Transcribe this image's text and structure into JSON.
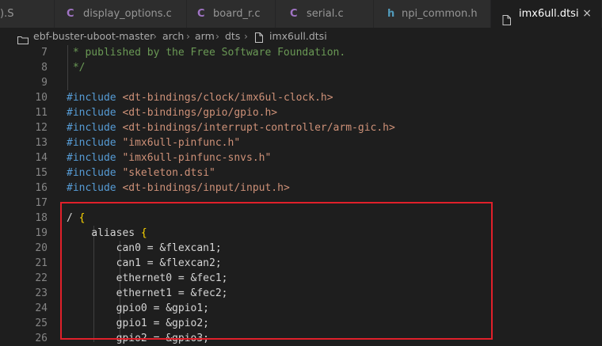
{
  "tabs": [
    {
      "label": ").S",
      "icon": "",
      "active": false
    },
    {
      "label": "display_options.c",
      "icon": "C",
      "active": false
    },
    {
      "label": "board_r.c",
      "icon": "C",
      "active": false
    },
    {
      "label": "serial.c",
      "icon": "C",
      "active": false
    },
    {
      "label": "npi_common.h",
      "icon": "h",
      "active": false
    },
    {
      "label": "imx6ull.dtsi",
      "icon": "file-icon",
      "active": true,
      "close": "×"
    }
  ],
  "breadcrumb": [
    "ebf-buster-uboot-master",
    "arch",
    "arm",
    "dts",
    "imx6ull.dtsi"
  ],
  "colors": {
    "comment": "#6a9955",
    "keyword": "#569cd6",
    "string": "#ce9178",
    "text": "#d4d4d4",
    "bracket": "#ffd700",
    "highlight": "#e0202a",
    "csharp_icon": "#a074c4"
  },
  "lines": [
    {
      "n": "7",
      "parts": [
        {
          "t": " * published by the Free Software Foundation.",
          "c": "comment"
        }
      ]
    },
    {
      "n": "8",
      "parts": [
        {
          "t": " */",
          "c": "comment"
        }
      ]
    },
    {
      "n": "9",
      "parts": []
    },
    {
      "n": "10",
      "parts": [
        {
          "t": "#include ",
          "c": "keyword"
        },
        {
          "t": "<dt-bindings/clock/imx6ul-clock.h>",
          "c": "string"
        }
      ]
    },
    {
      "n": "11",
      "parts": [
        {
          "t": "#include ",
          "c": "keyword"
        },
        {
          "t": "<dt-bindings/gpio/gpio.h>",
          "c": "string"
        }
      ]
    },
    {
      "n": "12",
      "parts": [
        {
          "t": "#include ",
          "c": "keyword"
        },
        {
          "t": "<dt-bindings/interrupt-controller/arm-gic.h>",
          "c": "string"
        }
      ]
    },
    {
      "n": "13",
      "parts": [
        {
          "t": "#include ",
          "c": "keyword"
        },
        {
          "t": "\"imx6ull-pinfunc.h\"",
          "c": "string"
        }
      ]
    },
    {
      "n": "14",
      "parts": [
        {
          "t": "#include ",
          "c": "keyword"
        },
        {
          "t": "\"imx6ull-pinfunc-snvs.h\"",
          "c": "string"
        }
      ]
    },
    {
      "n": "15",
      "parts": [
        {
          "t": "#include ",
          "c": "keyword"
        },
        {
          "t": "\"skeleton.dtsi\"",
          "c": "string"
        }
      ]
    },
    {
      "n": "16",
      "parts": [
        {
          "t": "#include ",
          "c": "keyword"
        },
        {
          "t": "<dt-bindings/input/input.h>",
          "c": "string"
        }
      ]
    },
    {
      "n": "17",
      "parts": []
    },
    {
      "n": "18",
      "parts": [
        {
          "t": "/ ",
          "c": "text"
        },
        {
          "t": "{",
          "c": "bracket"
        }
      ]
    },
    {
      "n": "19",
      "parts": [
        {
          "t": "    aliases ",
          "c": "text"
        },
        {
          "t": "{",
          "c": "bracket"
        }
      ]
    },
    {
      "n": "20",
      "parts": [
        {
          "t": "        can0 = &flexcan1;",
          "c": "text"
        }
      ]
    },
    {
      "n": "21",
      "parts": [
        {
          "t": "        can1 = &flexcan2;",
          "c": "text"
        }
      ]
    },
    {
      "n": "22",
      "parts": [
        {
          "t": "        ethernet0 = &fec1;",
          "c": "text"
        }
      ]
    },
    {
      "n": "23",
      "parts": [
        {
          "t": "        ethernet1 = &fec2;",
          "c": "text"
        }
      ]
    },
    {
      "n": "24",
      "parts": [
        {
          "t": "        gpio0 = &gpio1;",
          "c": "text"
        }
      ]
    },
    {
      "n": "25",
      "parts": [
        {
          "t": "        gpio1 = &gpio2;",
          "c": "text"
        }
      ]
    },
    {
      "n": "26",
      "parts": [
        {
          "t": "        gpio2 = &gpio3;",
          "c": "text"
        }
      ]
    }
  ]
}
